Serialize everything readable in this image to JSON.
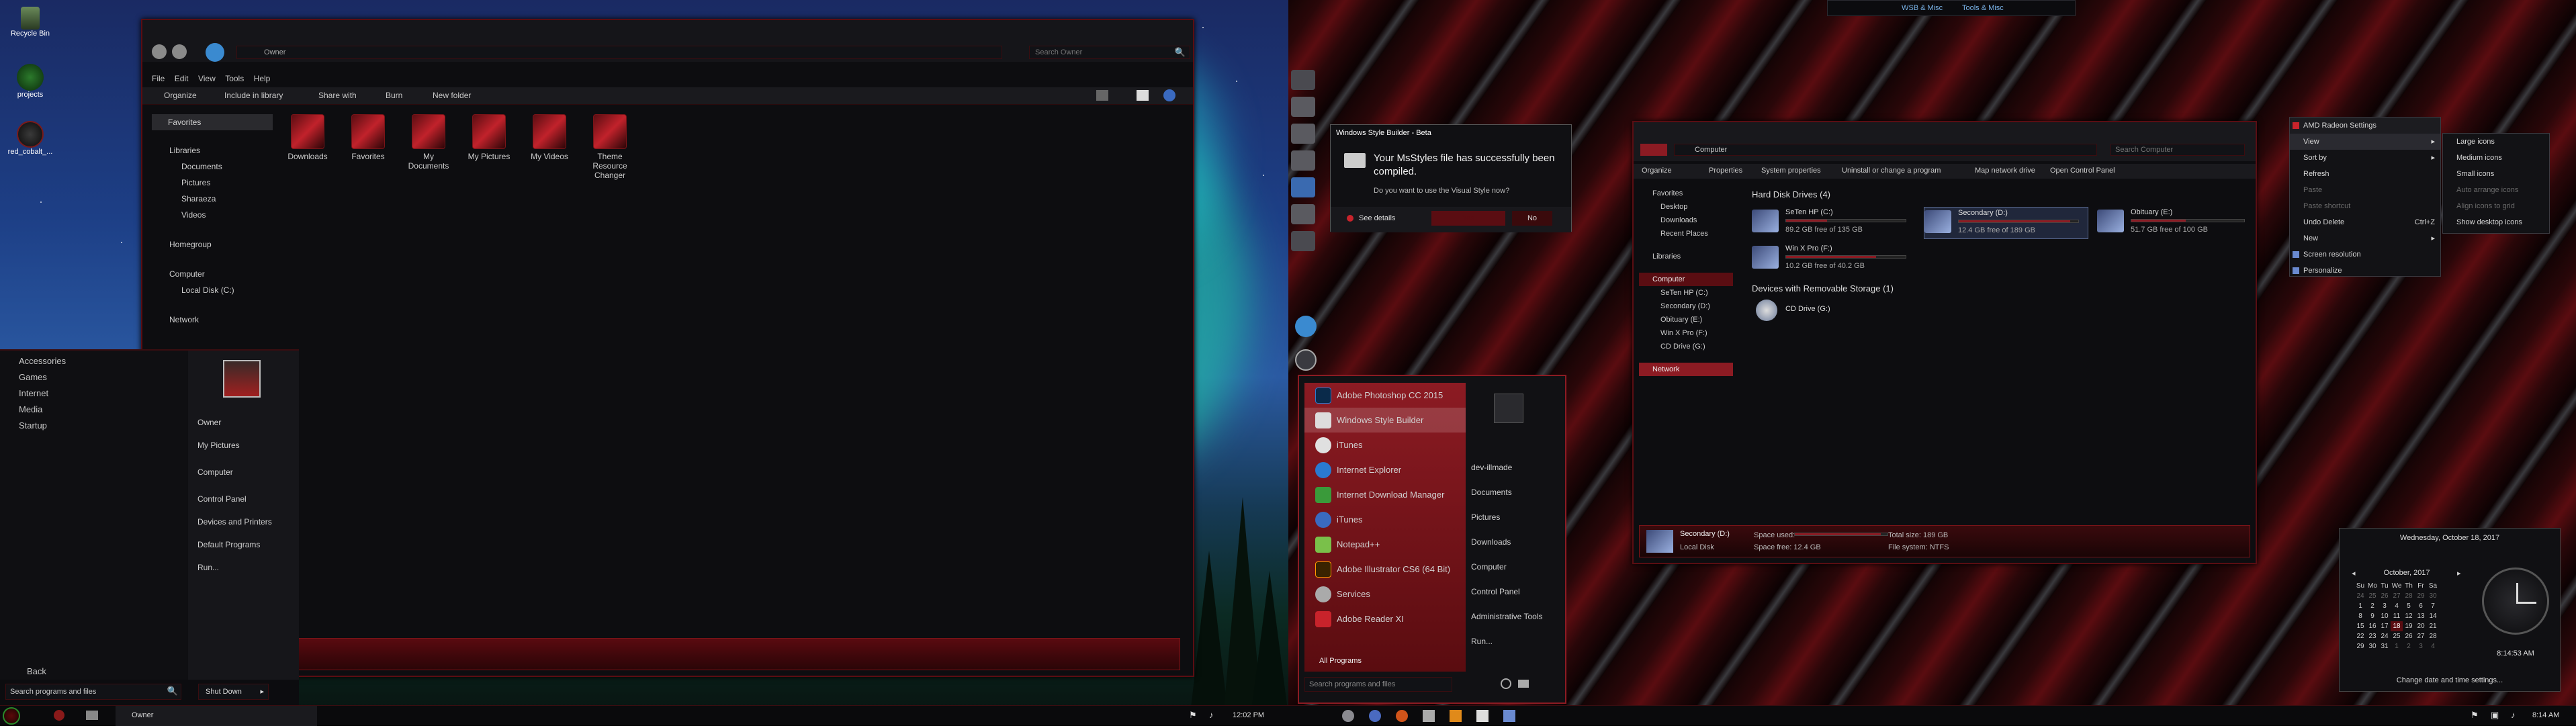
{
  "left_desktop": {
    "icons": [
      "Recycle Bin",
      "projects",
      "red_cobalt_..."
    ]
  },
  "explorer": {
    "window_caption": "Owner",
    "breadcrumb": "Owner",
    "search_placeholder": "Search Owner",
    "menu": [
      "File",
      "Edit",
      "View",
      "Tools",
      "Help"
    ],
    "toolbar": [
      "Organize",
      "Include in library",
      "Share with",
      "Burn",
      "New folder"
    ],
    "nav": {
      "favorites": "Favorites",
      "libraries": "Libraries",
      "library_items": [
        "Documents",
        "Pictures",
        "Sharaeza",
        "Videos"
      ],
      "homegroup": "Homegroup",
      "computer": "Computer",
      "local_disk": "Local Disk (C:)",
      "network": "Network"
    },
    "folders": [
      "Downloads",
      "Favorites",
      "My Documents",
      "My Pictures",
      "My Videos",
      "Theme Resource Changer"
    ]
  },
  "start_menu_left": {
    "programs": [
      "Accessories",
      "Games",
      "Internet",
      "Media",
      "Startup"
    ],
    "right_links": [
      "Owner",
      "My Pictures",
      "Computer",
      "Control Panel",
      "Devices and Printers",
      "Default Programs",
      "Run..."
    ],
    "back": "Back",
    "search_placeholder": "Search programs and files",
    "shutdown": "Shut Down"
  },
  "taskbar_left": {
    "pinned_label": "Owner",
    "time": "12:02 PM"
  },
  "dialog": {
    "title": "Windows Style Builder - Beta",
    "message": "Your MsStyles file has successfully been compiled.",
    "question": "Do you want to use the Visual Style now?",
    "see_details": "See details",
    "yes": "Yes",
    "no": "No"
  },
  "start_menu_right": {
    "programs": [
      "Adobe Photoshop CC 2015",
      "Windows Style Builder",
      "iTunes",
      "Internet Explorer",
      "Internet Download Manager",
      "iTunes",
      "Notepad++",
      "Adobe Illustrator CS6 (64 Bit)",
      "Services",
      "Adobe Reader XI"
    ],
    "all_programs": "All Programs",
    "search_placeholder": "Search programs and files",
    "right_links": [
      "dev-illmade",
      "Documents",
      "Pictures",
      "Downloads",
      "Computer",
      "Control Panel",
      "Administrative Tools",
      "Run..."
    ]
  },
  "computer_window": {
    "breadcrumb": "Computer",
    "search_placeholder": "Search Computer",
    "toolbar": [
      "Organize",
      "Properties",
      "System properties",
      "Uninstall or change a program",
      "Map network drive",
      "Open Control Panel"
    ],
    "nav": {
      "favorites": "Favorites",
      "fav_items": [
        "Desktop",
        "Downloads",
        "Recent Places"
      ],
      "libraries": "Libraries",
      "computer": "Computer",
      "computer_items": [
        "SeTen HP (C:)",
        "Secondary (D:)",
        "Obituary (E:)",
        "Win X Pro (F:)",
        "CD Drive (G:)"
      ],
      "network": "Network"
    },
    "hdd_header": "Hard Disk Drives (4)",
    "drives": [
      {
        "name": "SeTen HP (C:)",
        "free": "89.2 GB free of 135 GB",
        "used_fraction": 0.34
      },
      {
        "name": "Secondary (D:)",
        "free": "12.4 GB free of 189 GB",
        "used_fraction": 0.93
      },
      {
        "name": "Obituary (E:)",
        "free": "51.7 GB free of 100 GB",
        "used_fraction": 0.48
      },
      {
        "name": "Win X Pro (F:)",
        "free": "10.2 GB free of 40.2 GB",
        "used_fraction": 0.75
      }
    ],
    "removable_header": "Devices with Removable Storage (1)",
    "cd_drive": "CD Drive (G:)",
    "details": {
      "name": "Secondary (D:)",
      "type": "Local Disk",
      "space_used_label": "Space used:",
      "space_free": "Space free: 12.4 GB",
      "total_size": "Total size: 189 GB",
      "file_system": "File system: NTFS"
    }
  },
  "top_bar": {
    "items": [
      "WSB & Misc",
      "Tools & Misc"
    ]
  },
  "context_menu": {
    "header": "AMD Radeon Settings",
    "items": [
      "View",
      "Sort by",
      "Refresh",
      "Paste",
      "Paste shortcut",
      "Undo Delete",
      "New",
      "Screen resolution",
      "Personalize"
    ],
    "undo_shortcut": "Ctrl+Z",
    "submenu": [
      "Large icons",
      "Medium icons",
      "Small icons",
      "Auto arrange icons",
      "Align icons to grid",
      "Show desktop icons"
    ]
  },
  "calendar": {
    "date_header": "Wednesday, October 18, 2017",
    "month": "October, 2017",
    "weekdays": [
      "Su",
      "Mo",
      "Tu",
      "We",
      "Th",
      "Fr",
      "Sa"
    ],
    "days": [
      [
        "24",
        "25",
        "26",
        "27",
        "28",
        "29",
        "30"
      ],
      [
        "1",
        "2",
        "3",
        "4",
        "5",
        "6",
        "7"
      ],
      [
        "8",
        "9",
        "10",
        "11",
        "12",
        "13",
        "14"
      ],
      [
        "15",
        "16",
        "17",
        "18",
        "19",
        "20",
        "21"
      ],
      [
        "22",
        "23",
        "24",
        "25",
        "26",
        "27",
        "28"
      ],
      [
        "29",
        "30",
        "31",
        "1",
        "2",
        "3",
        "4"
      ]
    ],
    "digital_time": "8:14:53 AM",
    "footer": "Change date and time settings..."
  },
  "taskbar_right": {
    "time": "8:14 AM"
  }
}
